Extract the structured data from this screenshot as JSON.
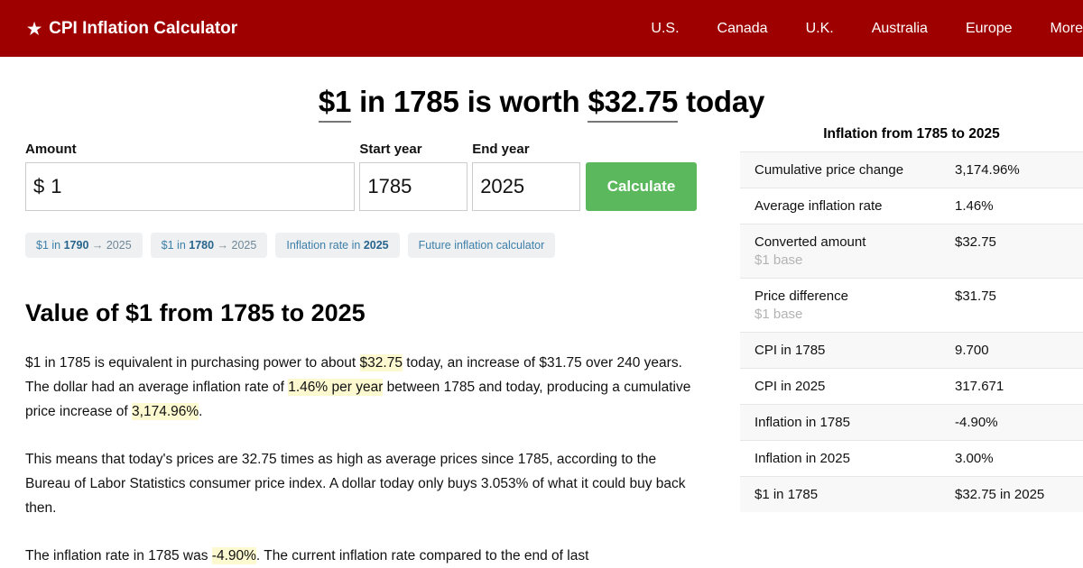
{
  "header": {
    "brand": "CPI Inflation Calculator",
    "brand_icon": "star-icon",
    "nav": [
      {
        "label": "U.S."
      },
      {
        "label": "Canada"
      },
      {
        "label": "U.K."
      },
      {
        "label": "Australia"
      },
      {
        "label": "Europe"
      },
      {
        "label": "More"
      }
    ]
  },
  "page_title": {
    "amount": "$1",
    "mid": " in 1785 is worth ",
    "result": "$32.75",
    "tail": " today"
  },
  "form": {
    "amount_label": "Amount",
    "amount_prefix": "$",
    "amount_value": "1",
    "start_label": "Start year",
    "start_value": "1785",
    "end_label": "End year",
    "end_value": "2025",
    "calculate_label": "Calculate"
  },
  "chips": [
    {
      "pre": "$1 in ",
      "bold": "1790",
      "arrow": " → ",
      "post": "2025"
    },
    {
      "pre": "$1 in ",
      "bold": "1780",
      "arrow": " → ",
      "post": "2025"
    },
    {
      "pre": "Inflation rate in ",
      "bold": "2025",
      "arrow": "",
      "post": ""
    },
    {
      "pre": "Future inflation calculator",
      "bold": "",
      "arrow": "",
      "post": ""
    }
  ],
  "article": {
    "title": "Value of $1 from 1785 to 2025",
    "p1_a": "$1 in 1785 is equivalent in purchasing power to about ",
    "p1_hl1": "$32.75",
    "p1_b": " today, an increase of $31.75 over 240 years. The dollar had an average inflation rate of ",
    "p1_hl2": "1.46% per year",
    "p1_c": " between 1785 and today, producing a cumulative price increase of ",
    "p1_hl3": "3,174.96%",
    "p1_d": ".",
    "p2": "This means that today's prices are 32.75 times as high as average prices since 1785, according to the Bureau of Labor Statistics consumer price index. A dollar today only buys 3.053% of what it could buy back then.",
    "p3_a": "The inflation rate in 1785 was ",
    "p3_hl": "-4.90%",
    "p3_b": ". The current inflation rate compared to the end of last"
  },
  "stats_table": {
    "caption": "Inflation from 1785 to 2025",
    "rows": [
      {
        "label": "Cumulative price change",
        "sub": "",
        "value": "3,174.96%"
      },
      {
        "label": "Average inflation rate",
        "sub": "",
        "value": "1.46%"
      },
      {
        "label": "Converted amount",
        "sub": "$1 base",
        "value": "$32.75"
      },
      {
        "label": "Price difference",
        "sub": "$1 base",
        "value": "$31.75"
      },
      {
        "label": "CPI in 1785",
        "sub": "",
        "value": "9.700"
      },
      {
        "label": "CPI in 2025",
        "sub": "",
        "value": "317.671"
      },
      {
        "label": "Inflation in 1785",
        "sub": "",
        "value": "-4.90%"
      },
      {
        "label": "Inflation in 2025",
        "sub": "",
        "value": "3.00%"
      },
      {
        "label": "$1 in 1785",
        "sub": "",
        "value": "$32.75 in 2025"
      }
    ]
  },
  "colors": {
    "header_red": "#9e0000",
    "button_green": "#5cb85c",
    "chip_blue": "#3d7fa8",
    "highlight_yellow": "#fcf8d0"
  }
}
